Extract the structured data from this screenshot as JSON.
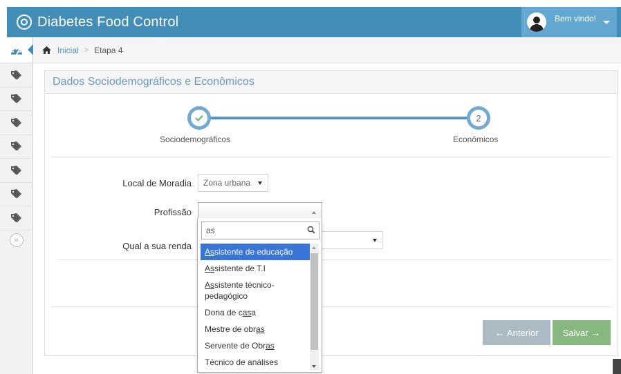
{
  "navbar": {
    "brand": "Diabetes Food Control",
    "welcome": "Bem vindo!",
    "color": "#438eb9"
  },
  "sidebar": {
    "items": [
      "dashboard-icon",
      "tag-icon",
      "tag-icon",
      "tag-icon",
      "tag-icon",
      "tag-icon",
      "tag-icon",
      "tag-icon"
    ]
  },
  "breadcrumb": {
    "home": "Inicial",
    "current": "Etapa 4"
  },
  "panel": {
    "title": "Dados Sociodemográficos e Econômicos"
  },
  "wizard": {
    "step1_label": "Sociodemográficos",
    "step2_label": "Econômicos",
    "step2_number": "2"
  },
  "form": {
    "local_label": "Local de Moradia",
    "local_value": "Zona urbana",
    "profissao_label": "Profissão",
    "profissao_value": "",
    "renda_label": "Qual a sua renda"
  },
  "dropdown": {
    "search_value": "as",
    "options": [
      {
        "pre": "",
        "match": "As",
        "post": "sistente de educação"
      },
      {
        "pre": "",
        "match": "As",
        "post": "sistente de T.I"
      },
      {
        "pre": "",
        "match": "As",
        "post": "sistente técnico-pedagógico"
      },
      {
        "pre": "Dona de c",
        "match": "as",
        "post": "a"
      },
      {
        "pre": "Mestre de obr",
        "match": "as",
        "post": ""
      },
      {
        "pre": "Servente de Obr",
        "match": "as",
        "post": ""
      },
      {
        "pre": "Técnico de análises",
        "match": "",
        "post": ""
      }
    ]
  },
  "buttons": {
    "prev": "Anterior",
    "save": "Salvar"
  }
}
